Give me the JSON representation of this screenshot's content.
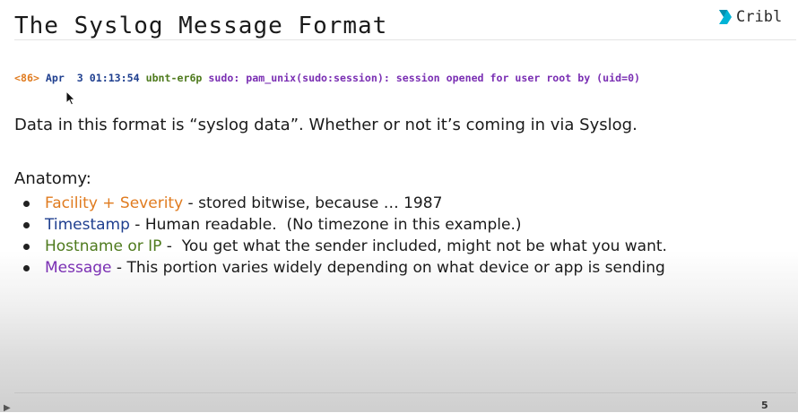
{
  "slide": {
    "title": "The Syslog Message Format",
    "page_number": "5"
  },
  "logo": {
    "icon": "cribl-icon",
    "text": "Cribl",
    "color": "#00b3d6"
  },
  "syslog_example": {
    "pri": "<86>",
    "timestamp": "Apr  3 01:13:54",
    "hostname": "ubnt-er6p",
    "message": "sudo: pam_unix(sudo:session): session opened for user root by (uid=0)"
  },
  "intro": "Data in this format is “syslog data”. Whether or not it’s coming in via Syslog.",
  "anatomy": {
    "heading": "Anatomy:",
    "items": [
      {
        "term": "Facility + Severity",
        "description": " - stored bitwise, because … 1987",
        "color": "#e07b1f"
      },
      {
        "term": "Timestamp",
        "description": " - Human readable.  (No timezone in this example.)",
        "color": "#1f3f8f"
      },
      {
        "term": "Hostname or IP",
        "description": " -  You get what the sender included, might not be what you want.",
        "color": "#4e7a1d"
      },
      {
        "term": "Message",
        "description": " - This portion varies widely depending on what device or app is sending",
        "color": "#7a2fb3"
      }
    ]
  },
  "colors": {
    "facility": "#e07b1f",
    "timestamp": "#1f3f8f",
    "hostname": "#4e7a1d",
    "message": "#7a2fb3"
  }
}
